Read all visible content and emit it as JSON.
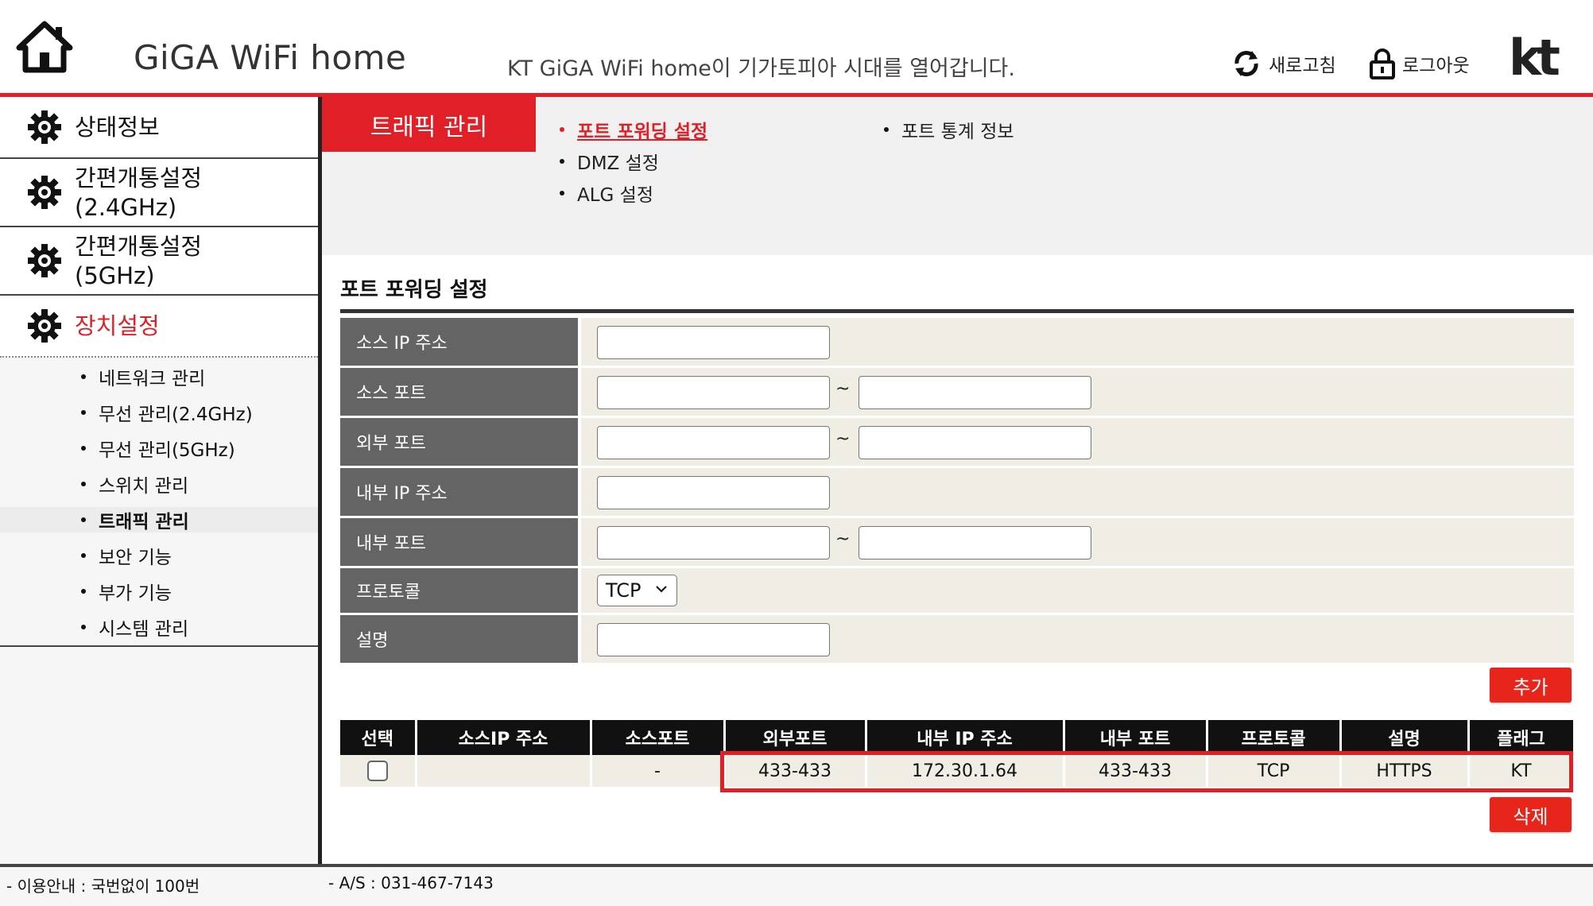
{
  "header": {
    "title": "GiGA WiFi home",
    "tagline": "KT GiGA WiFi home이 기가토피아 시대를 열어갑니다.",
    "refresh_label": "새로고침",
    "logout_label": "로그아웃",
    "logo_text": "kt",
    "icons": [
      "home-icon",
      "refresh-icon",
      "lock-icon",
      "kt-logo"
    ]
  },
  "sidebar": {
    "main_items": [
      {
        "label": "상태정보",
        "icon": "gear-icon"
      },
      {
        "label_line1": "간편개통설정",
        "label_line2": "(2.4GHz)",
        "icon": "gear-icon"
      },
      {
        "label_line1": "간편개통설정",
        "label_line2": "(5GHz)",
        "icon": "gear-icon"
      },
      {
        "label": "장치설정",
        "icon": "gear-icon",
        "active": true
      }
    ],
    "sub_items": [
      {
        "label": "네트워크 관리"
      },
      {
        "label": "무선 관리(2.4GHz)"
      },
      {
        "label": "무선 관리(5GHz)"
      },
      {
        "label": "스위치 관리"
      },
      {
        "label": "트래픽 관리",
        "active": true
      },
      {
        "label": "보안 기능"
      },
      {
        "label": "부가 기능"
      },
      {
        "label": "시스템 관리"
      }
    ]
  },
  "topnav": {
    "section_tab": "트래픽 관리",
    "links": [
      {
        "label": "포트 포워딩 설정",
        "active": true
      },
      {
        "label": "DMZ 설정"
      },
      {
        "label": "ALG 설정"
      },
      {
        "label": "포트 통계 정보"
      }
    ]
  },
  "form": {
    "title": "포트 포워딩 설정",
    "rows": [
      {
        "label": "소스 IP 주소",
        "value": ""
      },
      {
        "label": "소스 포트",
        "from": "",
        "to": "",
        "sep": "~"
      },
      {
        "label": "외부 포트",
        "from": "",
        "to": "",
        "sep": "~"
      },
      {
        "label": "내부 IP 주소",
        "value": ""
      },
      {
        "label": "내부 포트",
        "from": "",
        "to": "",
        "sep": "~"
      },
      {
        "label": "프로토콜",
        "selected": "TCP"
      },
      {
        "label": "설명",
        "value": ""
      }
    ],
    "add_button": "추가",
    "delete_button": "삭제"
  },
  "table": {
    "columns": [
      "선택",
      "소스IP 주소",
      "소스포트",
      "외부포트",
      "내부 IP 주소",
      "내부 포트",
      "프로토콜",
      "설명",
      "플래그"
    ],
    "rows": [
      {
        "source_ip": "",
        "source_port": "-",
        "external_port": "433-433",
        "internal_ip": "172.30.1.64",
        "internal_port": "433-433",
        "protocol": "TCP",
        "description": "HTTPS",
        "flag": "KT"
      }
    ]
  },
  "footer": {
    "info": "- 이용안내 : 국번없이 100번",
    "as": "- A/S : 031-467-7143"
  },
  "colors": {
    "accent": "#e01f26",
    "label_bg": "#646464",
    "field_bg": "#efede4",
    "header_bg": "#111111"
  }
}
